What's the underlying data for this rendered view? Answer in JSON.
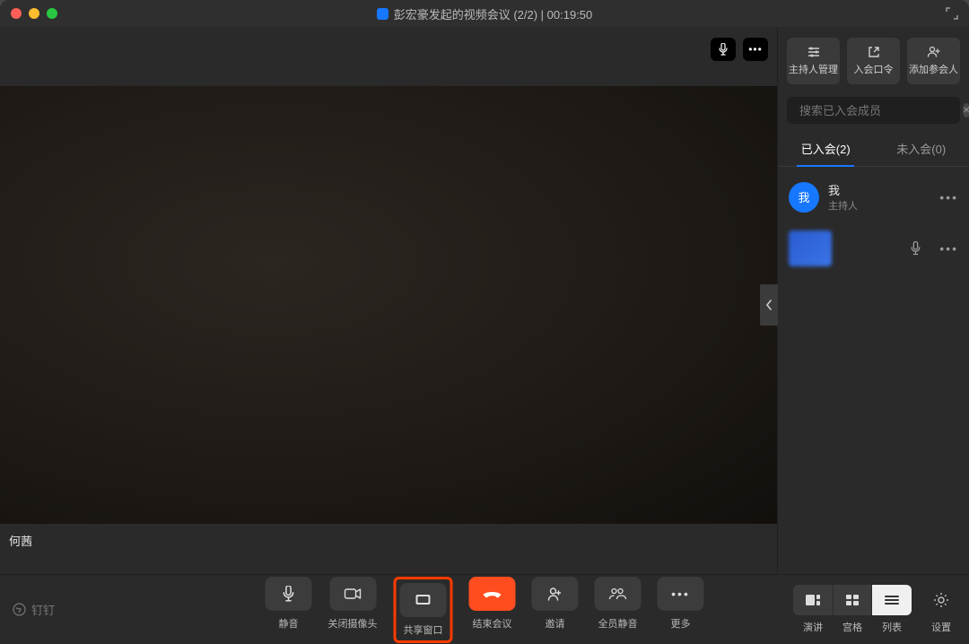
{
  "window": {
    "title": "彭宏豪发起的视频会议 (2/2) | 00:19:50"
  },
  "video": {
    "participant_name": "何茜"
  },
  "sidebar": {
    "actions": {
      "host_manage": "主持人管理",
      "join_code": "入会口令",
      "add_participant": "添加参会人"
    },
    "search_placeholder": "搜索已入会成员",
    "tabs": {
      "joined": "已入会(2)",
      "not_joined": "未入会(0)"
    },
    "participants": [
      {
        "name": "我",
        "role": "主持人",
        "avatar_text": "我"
      }
    ]
  },
  "toolbar": {
    "mute": "静音",
    "camera": "关闭摄像头",
    "share": "共享窗口",
    "end": "结束会议",
    "invite": "邀请",
    "mute_all": "全员静音",
    "more": "更多"
  },
  "views": {
    "speaker": "演讲",
    "grid": "宫格",
    "list": "列表",
    "settings": "设置"
  },
  "brand": "钉钉"
}
